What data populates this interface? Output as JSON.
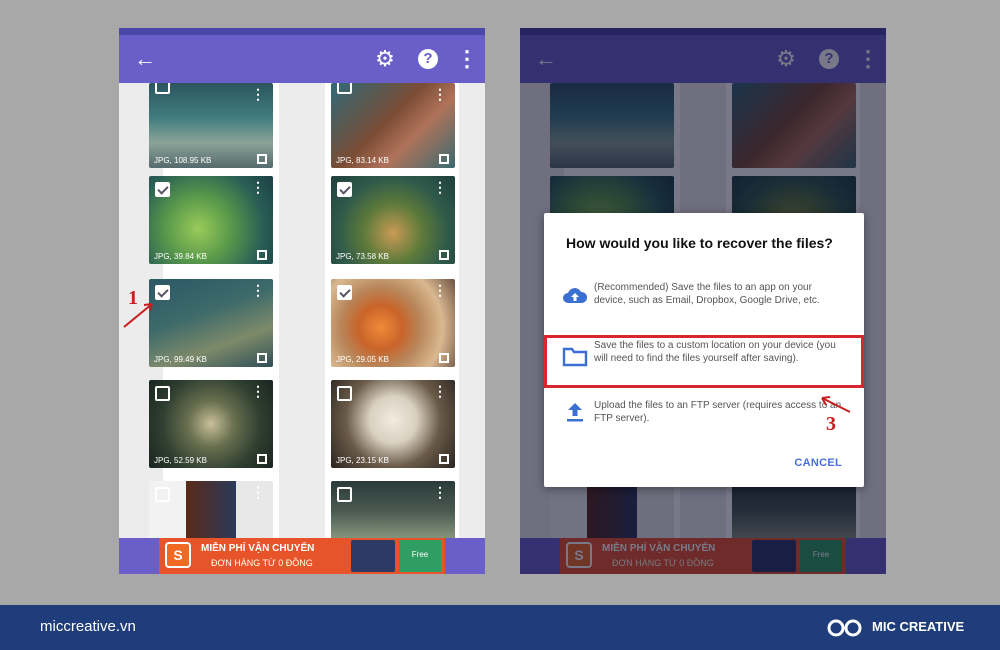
{
  "left_phone": {
    "thumbs": [
      {
        "meta": "JPG, 108.95 KB",
        "checked": false
      },
      {
        "meta": "JPG, 83.14 KB",
        "checked": false
      },
      {
        "meta": "JPG, 39.84 KB",
        "checked": true
      },
      {
        "meta": "JPG, 73.58 KB",
        "checked": true
      },
      {
        "meta": "JPG, 99.49 KB",
        "checked": true
      },
      {
        "meta": "JPG, 29.05 KB",
        "checked": true
      },
      {
        "meta": "JPG, 52.59 KB",
        "checked": false
      },
      {
        "meta": "JPG, 23.15 KB",
        "checked": false
      },
      {
        "meta": "",
        "checked": false
      },
      {
        "meta": "",
        "checked": false
      }
    ]
  },
  "ad": {
    "line1": "MIỄN PHÍ VẬN CHUYỂN",
    "line2": "ĐƠN HÀNG TỪ 0 ĐỒNG",
    "close_label": "Free"
  },
  "dialog": {
    "title": "How would you like to recover the files?",
    "options": [
      {
        "icon": "cloud-upload-icon",
        "text": "(Recommended) Save the files to an app on your device, such as Email, Dropbox, Google Drive, etc."
      },
      {
        "icon": "folder-icon",
        "text": "Save the files to a custom location on your device (you will need to find the files yourself after saving)."
      },
      {
        "icon": "upload-icon",
        "text": "Upload the files to an FTP server (requires access to an FTP server)."
      }
    ],
    "cancel_label": "CANCEL"
  },
  "annotations": {
    "step1": "1",
    "step3": "3"
  },
  "footer": {
    "website": "miccreative.vn",
    "brand": "MIC CREATIVE"
  },
  "colors": {
    "appbar": "#6a5fc8",
    "highlight": "#d7262e",
    "footer": "#1f3d7a",
    "accent": "#4a6fdc"
  }
}
